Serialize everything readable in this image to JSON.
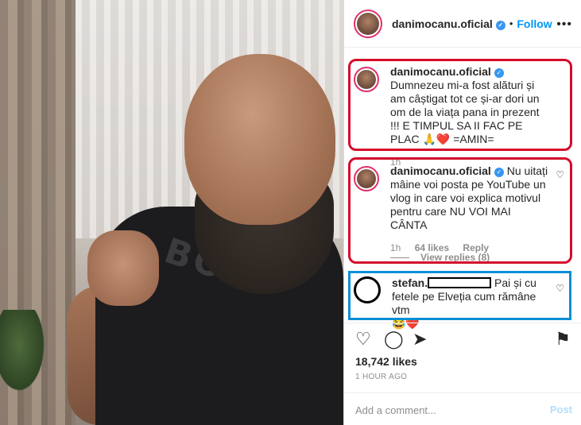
{
  "post": {
    "username": "danimocanu.oficial",
    "follow_label": "Follow",
    "dot": "•",
    "more": "•••",
    "likes": "18,742 likes",
    "time_ago": "1 HOUR AGO",
    "shirt_text": "BOSS"
  },
  "caption": {
    "username": "danimocanu.oficial",
    "text": "Dumnezeu mi-a fost alături și am câștigat tot ce și-ar dori un om de la viața pana in prezent !!! E TIMPUL SA II FAC PE PLAC 🙏❤️ =AMIN=",
    "time": "1h"
  },
  "comment_owner": {
    "username": "danimocanu.oficial",
    "text": "Nu uitați mâine voi posta pe YouTube un vlog in care voi explica motivul pentru care NU VOI MAI CÂNTA",
    "time": "1h",
    "likes": "64 likes",
    "reply": "Reply",
    "view_replies": "View replies (8)"
  },
  "comment_user": {
    "username": "stefan.",
    "text": "Pai și cu fetele pe Elveția cum rămâne vtm",
    "emoji": "😂❤️"
  },
  "actions": {
    "like_icon": "♡",
    "comment_icon": "◯",
    "share_icon": "➤",
    "save_icon": "⚑",
    "heart_small": "♡",
    "verified_icon": "✓"
  },
  "add_comment": {
    "placeholder": "Add a comment...",
    "post_label": "Post"
  },
  "colors": {
    "highlight_red": "#d40c2b",
    "highlight_blue": "#0a8fd6",
    "link_blue": "#0095f6"
  }
}
